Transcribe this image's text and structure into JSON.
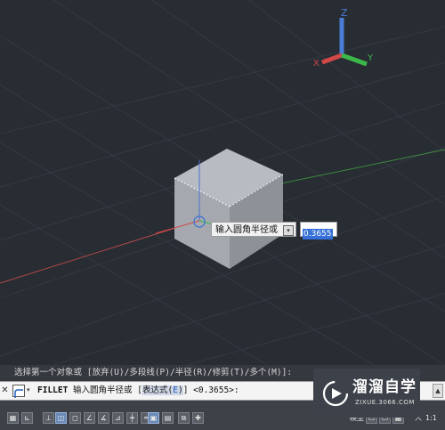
{
  "viewport": {
    "ucs_icon": {
      "z_label": "Z",
      "x_label": "X",
      "y_label": "Y"
    },
    "dynamic_input": {
      "prompt": "输入圆角半径或",
      "dropdown_glyph": "▾",
      "value": "0.3655"
    }
  },
  "command": {
    "history": "选择第一个对象或 [放弃(U)/多段线(P)/半径(R)/修剪(T)/多个(M)]:",
    "close_glyph": "✕",
    "dropdown_glyph": "▾",
    "name": "FILLET",
    "prompt_before": " 输入圆角半径或 [",
    "option_text": "表达式(",
    "option_key": "E",
    "option_close": ")",
    "prompt_after": "] <0.3655>:",
    "scroll_glyph": "▲"
  },
  "status_bar": {
    "model_label": "模型",
    "scale_label": "1:1",
    "annotation_glyph": "人"
  },
  "watermark": {
    "title": "溜溜自学",
    "url": "ZIXUE.3066.COM"
  },
  "colors": {
    "viewport_bg": "#282c33",
    "grid_line": "#343943",
    "axis_x_red": "#b04a4a",
    "axis_y_green": "#3d8a3d",
    "ucs_z_blue": "#4a7cd6",
    "ucs_x_red": "#d04848",
    "ucs_y_green": "#3cb84a",
    "cube_top": "#b8bcc2",
    "cube_left": "#a5a9af",
    "cube_right": "#8e9298",
    "selection_blue": "#3470d8"
  }
}
